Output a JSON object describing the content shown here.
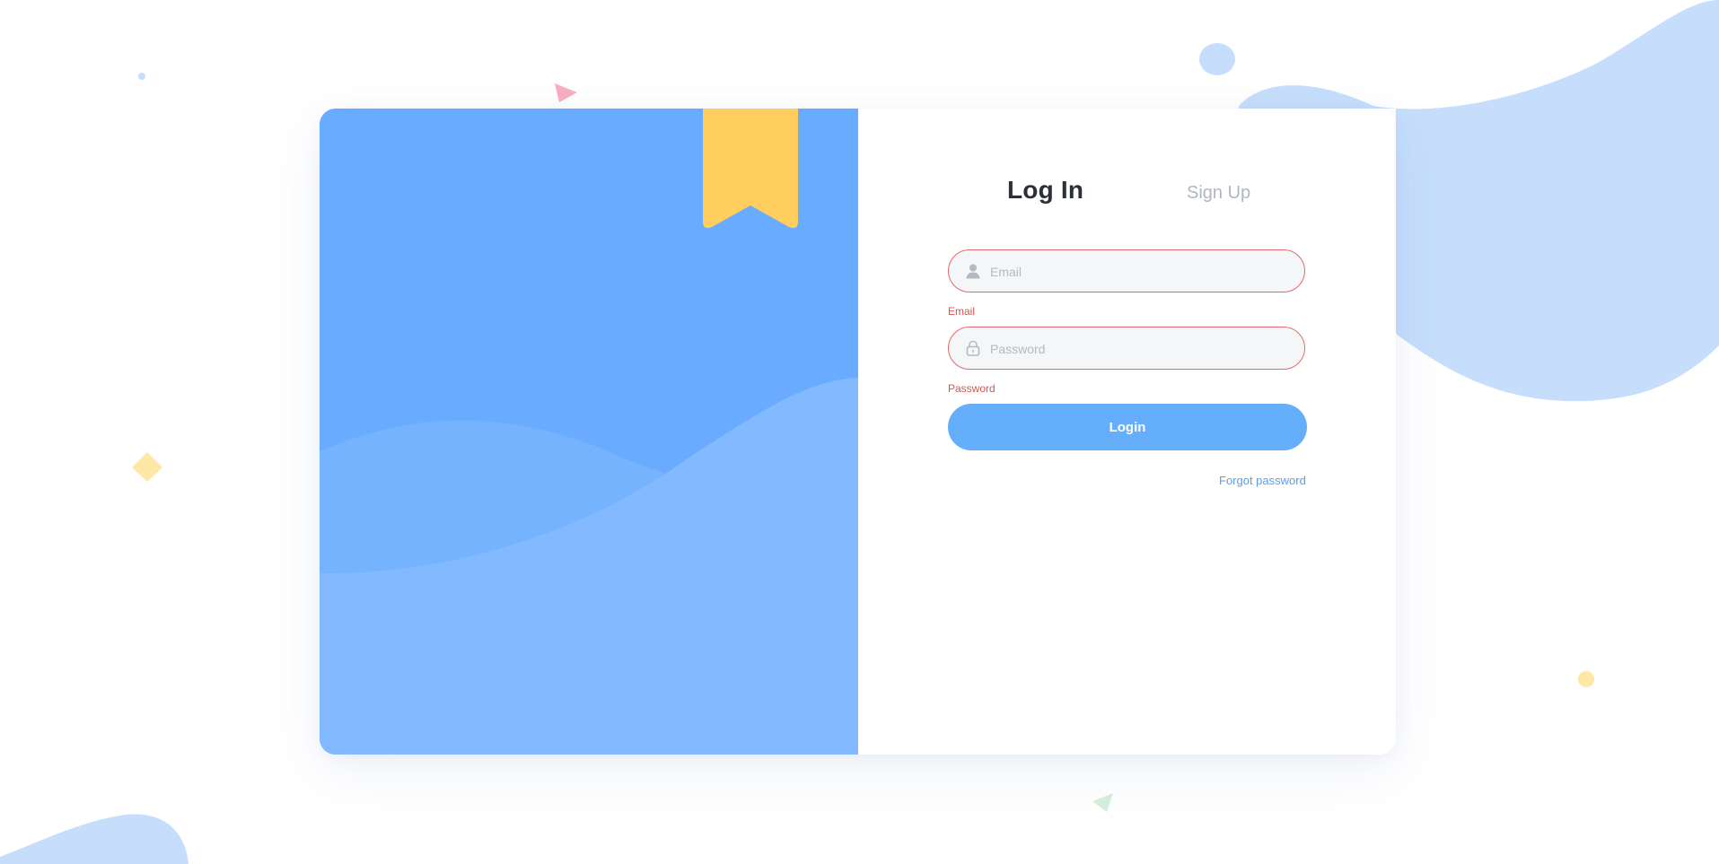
{
  "tabs": {
    "login": "Log In",
    "signup": "Sign Up"
  },
  "form": {
    "email": {
      "placeholder": "Email",
      "value": "",
      "error": "Email",
      "icon": "user-icon"
    },
    "password": {
      "placeholder": "Password",
      "value": "",
      "error": "Password",
      "icon": "lock-icon"
    },
    "login_label": "Login",
    "forgot_label": "Forgot password"
  },
  "colors": {
    "panel_blue": "#69abfe",
    "button_blue": "#64aefc",
    "bookmark_yellow": "#ffce5e",
    "error_red": "#d9534f",
    "link_blue": "#5b9ee8",
    "blob_light_blue": "#c6defc"
  }
}
